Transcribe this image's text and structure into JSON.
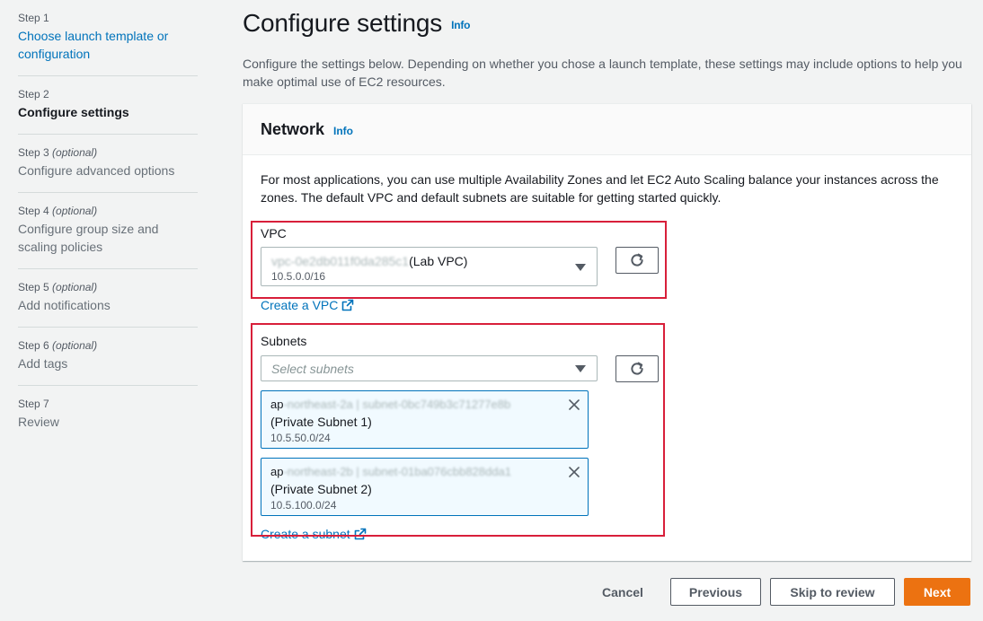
{
  "steps": [
    {
      "num": "Step 1",
      "optional": "",
      "title": "Choose launch template or configuration",
      "state": "link"
    },
    {
      "num": "Step 2",
      "optional": "",
      "title": "Configure settings",
      "state": "active"
    },
    {
      "num": "Step 3",
      "optional": "(optional)",
      "title": "Configure advanced options",
      "state": "disabled"
    },
    {
      "num": "Step 4",
      "optional": "(optional)",
      "title": "Configure group size and scaling policies",
      "state": "disabled"
    },
    {
      "num": "Step 5",
      "optional": "(optional)",
      "title": "Add notifications",
      "state": "disabled"
    },
    {
      "num": "Step 6",
      "optional": "(optional)",
      "title": "Add tags",
      "state": "disabled"
    },
    {
      "num": "Step 7",
      "optional": "",
      "title": "Review",
      "state": "disabled"
    }
  ],
  "page": {
    "title": "Configure settings",
    "info": "Info",
    "description": "Configure the settings below. Depending on whether you chose a launch template, these settings may include options to help you make optimal use of EC2 resources."
  },
  "network": {
    "title": "Network",
    "info": "Info",
    "description": "For most applications, you can use multiple Availability Zones and let EC2 Auto Scaling balance your instances across the zones. The default VPC and default subnets are suitable for getting started quickly.",
    "vpc": {
      "label": "VPC",
      "selected_id": "vpc-0e2db011f0da285c1",
      "selected_name": "(Lab VPC)",
      "cidr": "10.5.0.0/16",
      "create_link": "Create a VPC"
    },
    "subnets": {
      "label": "Subnets",
      "placeholder": "Select subnets",
      "selected": [
        {
          "az_prefix": "ap",
          "az_rest": "-northeast-2a | subnet-0bc749b3c71277e8b",
          "name": "(Private Subnet 1)",
          "cidr": "10.5.50.0/24"
        },
        {
          "az_prefix": "ap",
          "az_rest": "-northeast-2b | subnet-01ba076cbb828dda1",
          "name": "(Private Subnet 2)",
          "cidr": "10.5.100.0/24"
        }
      ],
      "create_link": "Create a subnet"
    }
  },
  "footer": {
    "cancel": "Cancel",
    "previous": "Previous",
    "skip": "Skip to review",
    "next": "Next"
  },
  "colors": {
    "primary": "#ec7211",
    "link": "#0073bb",
    "highlight": "#d81f3a"
  }
}
